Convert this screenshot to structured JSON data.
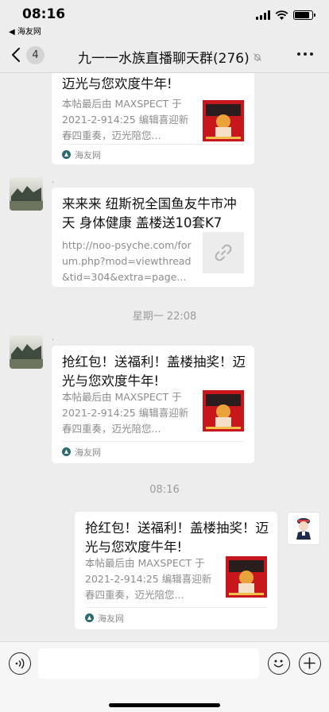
{
  "status": {
    "time": "08:16",
    "back_app": "◀ 海友网",
    "battery_level": 0.85
  },
  "nav": {
    "back_icon": "chevron-left-icon",
    "unread_count": "4",
    "title": "九一一水族直播聊天群(276)",
    "mute_icon": "bell-slash-icon",
    "more_icon": "ellipsis-icon"
  },
  "messages": [
    {
      "title": "迈光与您欢度牛年!",
      "desc": "本帖最后由 MAXSPECT 于 2021-2-914:25 编辑喜迎新春四重奏，迈光陪您...",
      "source": "海友网"
    },
    {
      "sender": ".",
      "title": "来来来 纽斯祝全国鱼友牛市冲天 身体健康 盖楼送10套K7",
      "desc": "http://noo-psyche.com/forum.php?mod=viewthread&tid=304&extra=page...",
      "thumb_icon": "link-icon"
    },
    {
      "sender": ".",
      "title": "抢红包！送福利！盖楼抽奖！迈光与您欢度牛年!",
      "desc": "本帖最后由 MAXSPECT 于 2021-2-914:25 编辑喜迎新春四重奏，迈光陪您...",
      "source": "海友网"
    },
    {
      "title": "抢红包！送福利！盖楼抽奖！迈光与您欢度牛年!",
      "desc": "本帖最后由 MAXSPECT 于 2021-2-914:25 编辑喜迎新春四重奏，迈光陪您...",
      "source": "海友网"
    }
  ],
  "timestamps": [
    "星期一 22:08",
    "08:16"
  ],
  "input": {
    "voice_icon": "voice-icon",
    "emoji_icon": "emoji-icon",
    "plus_icon": "plus-icon",
    "placeholder": ""
  },
  "colors": {
    "background": "#ededed",
    "bubble": "#ffffff",
    "meta_text": "#9b9b9b"
  }
}
